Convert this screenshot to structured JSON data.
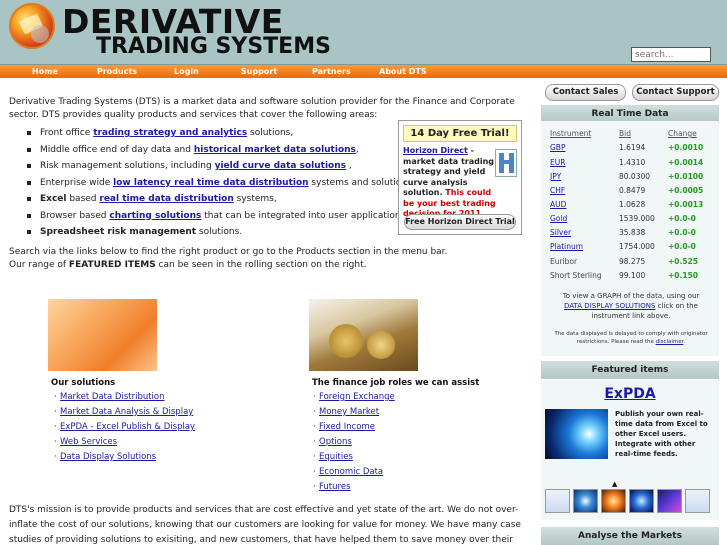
{
  "header": {
    "title_line1": "DERIVATIVE",
    "title_line2": "TRADING SYSTEMS",
    "search_placeholder": "search..."
  },
  "nav": [
    "Home",
    "Products",
    "Login",
    "Support",
    "Partners",
    "About DTS"
  ],
  "intro": {
    "text": "Derivative Trading Systems (DTS)  is a market data and software solution provider for the Finance and Corporate sector. DTS provides quality products and services that cover the following areas:"
  },
  "bullets": [
    {
      "pre": "Front office ",
      "link": "trading strategy and analytics",
      "post": " solutions,"
    },
    {
      "pre": "Middle office end of day data and ",
      "link": "historical market data solutions",
      "post": ","
    },
    {
      "pre": "Risk management solutions, including ",
      "link": "yield curve data solutions",
      "post": " ,"
    },
    {
      "pre": "Enterprise wide ",
      "link": "low latency real time data distribution",
      "post": " systems and solutions,"
    },
    {
      "bold_pre": "Excel",
      "pre": " based ",
      "link": "real time data distribution",
      "post": " systems,"
    },
    {
      "pre": "Browser based ",
      "link": "charting solutions",
      "post": " that can be integrated into user applications,"
    },
    {
      "bold_pre": "Spreadsheet risk management",
      "pre": " solutions.",
      "link": "",
      "post": ""
    }
  ],
  "trial": {
    "title": "14 Day Free Trial!",
    "link": "Horizon Direct",
    "dash": " -",
    "desc": "market data trading strategy and yield curve analysis solution.",
    "red": "This could be your best trading decision for 2011.",
    "button": "Free Horizon Direct Trial"
  },
  "search_text": {
    "line1": "Search via the links below to find the right product or go to the Products section in the menu bar.",
    "line2_pre": "Our range of ",
    "line2_bold": "FEATURED ITEMS",
    "line2_post": " can be seen in the rolling section on the right."
  },
  "solutions": {
    "heading": "Our solutions",
    "items": [
      "Market Data Distribution",
      "Market Data Analysis & Display",
      "ExPDA - Excel Publish & Display",
      "Web Services",
      "Data Display Solutions"
    ]
  },
  "finance": {
    "heading": "The finance job roles we can assist",
    "items": [
      "Foreign Exchange",
      "Money Market",
      "Fixed Income",
      "Options",
      "Equities",
      "Economic Data",
      "Futures"
    ]
  },
  "mission": "DTS's mission is to provide products and services that are cost effective and yet state of the art. We do not over-inflate the cost of our solutions, knowing that our customers are looking for value for money. We have many case studies of providing solutions to exisiting, and new customers, that have helped them to save money over their existing solutions, either by replacing more costly products or",
  "right": {
    "contact_sales": "Contact Sales",
    "contact_support": "Contact Support",
    "realtime_head": "Real Time Data",
    "rates_headers": [
      "Instrument",
      "Bid",
      "Change"
    ],
    "rates": [
      {
        "inst": "GBP",
        "bid": "1.6194",
        "chg": "+0.0010",
        "linked": true
      },
      {
        "inst": "EUR",
        "bid": "1.4310",
        "chg": "+0.0014",
        "linked": true
      },
      {
        "inst": "JPY",
        "bid": "80.0300",
        "chg": "+0.0100",
        "linked": true
      },
      {
        "inst": "CHF",
        "bid": "0.8479",
        "chg": "+0.0005",
        "linked": true
      },
      {
        "inst": "AUD",
        "bid": "1.0628",
        "chg": "+0.0013",
        "linked": true
      },
      {
        "inst": "Gold",
        "bid": "1539.000",
        "chg": "+0.0-0",
        "linked": true
      },
      {
        "inst": "Silver",
        "bid": "35.838",
        "chg": "+0.0-0",
        "linked": true
      },
      {
        "inst": "Platinum",
        "bid": "1754.000",
        "chg": "+0.0-0",
        "linked": true
      },
      {
        "inst": "Euribor",
        "bid": "98.275",
        "chg": "+0.525",
        "linked": false
      },
      {
        "inst": "Short Sterling",
        "bid": "99.100",
        "chg": "+0.150",
        "linked": false
      }
    ],
    "graph_note_pre": "To view a GRAPH of the data, using our",
    "graph_note_link": "DATA DISPLAY SOLUTIONS",
    "graph_note_post": "click on the instrument link above.",
    "disclaimer_pre": "The data displayed is delayed to comply with originator restrictions. Please read the ",
    "disclaimer_link": "disclaimer",
    "disclaimer_post": ".",
    "featured_head": "Featured items",
    "expda_title": "ExPDA",
    "expda_desc": "Publish your own real-time data from Excel to other Excel users. Integrate with other real-time feeds.",
    "analyse_head": "Analyse the Markets"
  }
}
